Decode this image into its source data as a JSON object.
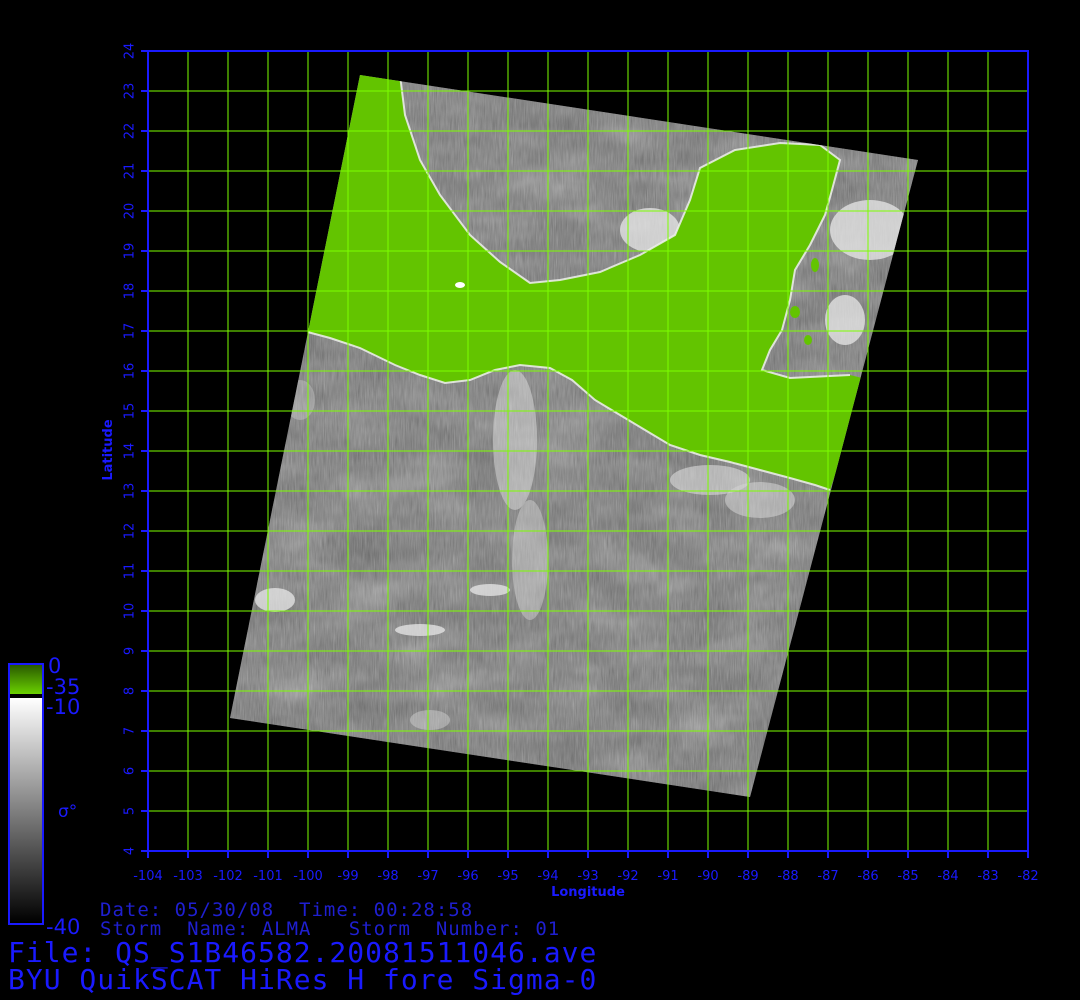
{
  "map": {
    "x_axis": {
      "title": "Longitude",
      "ticks": [
        "-104",
        "-103",
        "-102",
        "-101",
        "-100",
        "-99",
        "-98",
        "-97",
        "-96",
        "-95",
        "-94",
        "-93",
        "-92",
        "-91",
        "-90",
        "-89",
        "-88",
        "-87",
        "-86",
        "-85",
        "-84",
        "-83",
        "-82"
      ]
    },
    "y_axis": {
      "title": "Latitude",
      "ticks": [
        "4",
        "5",
        "6",
        "7",
        "8",
        "9",
        "10",
        "11",
        "12",
        "13",
        "14",
        "15",
        "16",
        "17",
        "18",
        "19",
        "20",
        "21",
        "22",
        "23",
        "24"
      ]
    },
    "colors": {
      "grid": "#7dff00",
      "axis": "#1a1aff",
      "land": "#66cc00",
      "background": "#000000"
    }
  },
  "colorbar": {
    "labels": [
      "0",
      "-35",
      "-10",
      "-40"
    ],
    "symbol": "σ°"
  },
  "info": {
    "date_line": "Date: 05/30/08  Time: 00:28:58",
    "storm_line": "Storm  Name: ALMA   Storm  Number: 01",
    "file_line": "File: QS_S1B46582.20081511046.ave",
    "product_line": "BYU QuikSCAT HiRes H fore Sigma-0"
  }
}
